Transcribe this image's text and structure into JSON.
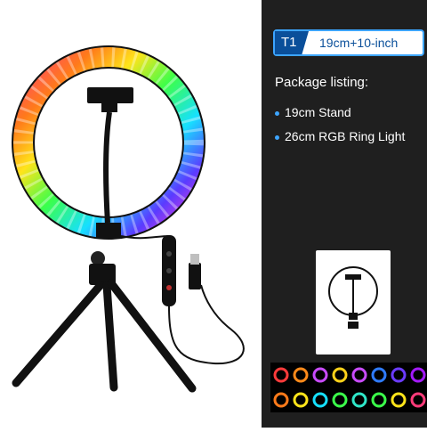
{
  "badge": {
    "tag": "T1",
    "text": "19cm+10-inch"
  },
  "package": {
    "title": "Package listing:",
    "items": [
      "19cm Stand",
      "26cm RGB Ring Light"
    ]
  },
  "colors": {
    "panel": "#1f1f1f",
    "accent": "#3da5ff",
    "tag": "#0a4f9a"
  }
}
